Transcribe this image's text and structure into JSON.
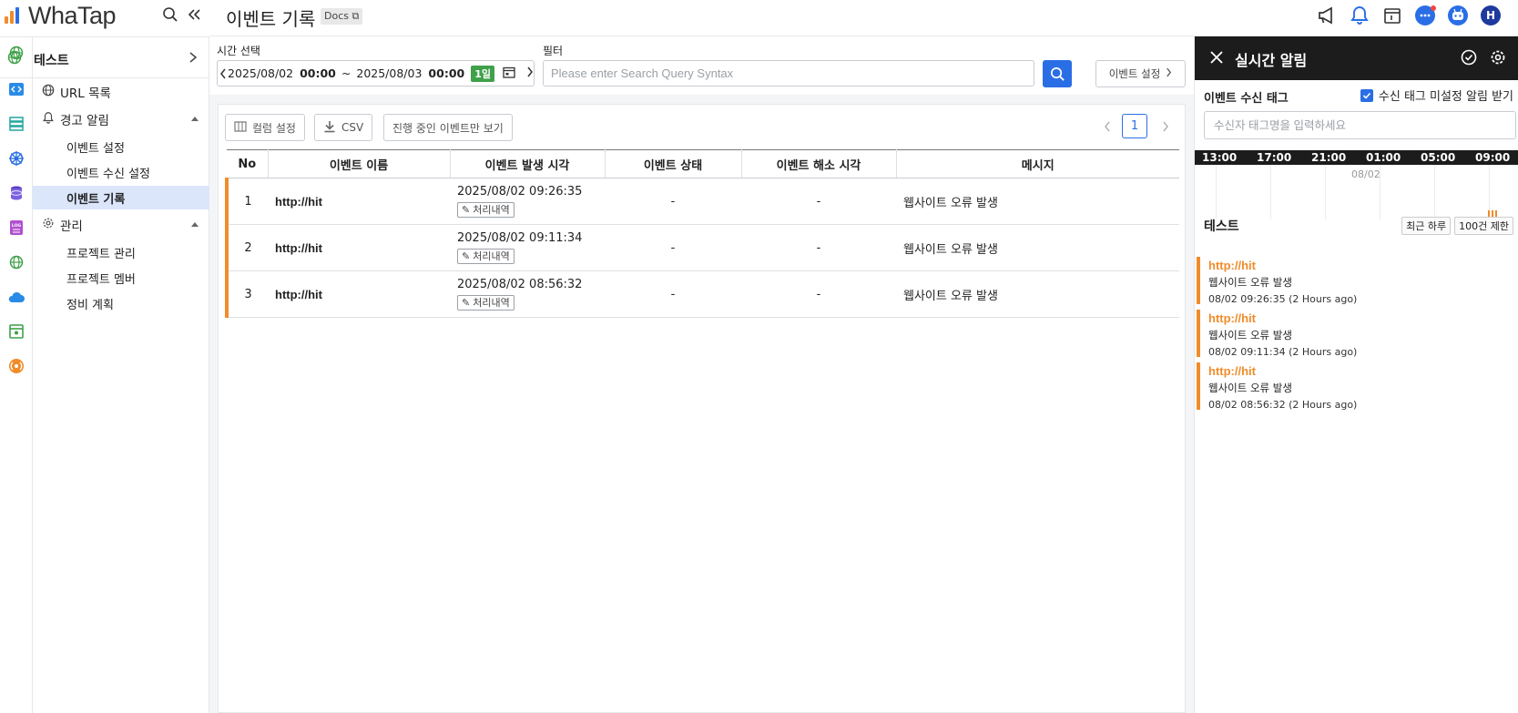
{
  "app": {
    "logo": "WhaTap"
  },
  "header": {
    "title": "이벤트 기록",
    "docs_label": "Docs"
  },
  "sidebar": {
    "project_name": "테스트",
    "items": [
      {
        "label": "URL 목록",
        "level": 1
      },
      {
        "label": "경고 알림",
        "level": 1
      },
      {
        "label": "이벤트 설정",
        "level": 2
      },
      {
        "label": "이벤트 수신 설정",
        "level": 2
      },
      {
        "label": "이벤트 기록",
        "level": 2,
        "active": true
      },
      {
        "label": "관리",
        "level": 1
      },
      {
        "label": "프로젝트 관리",
        "level": 2
      },
      {
        "label": "프로젝트 멤버",
        "level": 2
      },
      {
        "label": "정비 계획",
        "level": 2
      }
    ]
  },
  "filters": {
    "time_label": "시간 선택",
    "filter_label": "필터",
    "start_date": "2025/08/02",
    "start_time": "00:00",
    "separator": "~",
    "end_date": "2025/08/03",
    "end_time": "00:00",
    "range_badge": "1일",
    "filter_placeholder": "Please enter Search Query Syntax",
    "event_settings_button": "이벤트 설정"
  },
  "toolbar": {
    "column_settings": "컬럼 설정",
    "csv": "CSV",
    "ongoing_only": "진행 중인 이벤트만 보기",
    "current_page": "1"
  },
  "table": {
    "columns": [
      "No",
      "이벤트 이름",
      "이벤트 발생 시각",
      "이벤트 상태",
      "이벤트 해소 시각",
      "메시지"
    ],
    "process_tag": "처리내역",
    "rows": [
      {
        "no": "1",
        "name": "http://hit",
        "time": "2025/08/02 09:26:35",
        "status": "-",
        "resolved": "-",
        "message": "웹사이트 오류 발생"
      },
      {
        "no": "2",
        "name": "http://hit",
        "time": "2025/08/02 09:11:34",
        "status": "-",
        "resolved": "-",
        "message": "웹사이트 오류 발생"
      },
      {
        "no": "3",
        "name": "http://hit",
        "time": "2025/08/02 08:56:32",
        "status": "-",
        "resolved": "-",
        "message": "웹사이트 오류 발생"
      }
    ]
  },
  "right_panel": {
    "title": "실시간 알림",
    "tag_label": "이벤트 수신 태그",
    "checkbox_label": "수신 태그 미설정 알림 받기",
    "checkbox_checked": true,
    "tag_placeholder": "수신자 태그명을 입력하세요",
    "timeline_ticks": [
      "13:00",
      "17:00",
      "21:00",
      "01:00",
      "05:00",
      "09:00"
    ],
    "timeline_date": "08/02",
    "section_name": "테스트",
    "btn_recent": "최근 하루",
    "btn_limit": "100건 제한",
    "alerts": [
      {
        "title": "http://hit",
        "message": "웹사이트 오류 발생",
        "time": "08/02 09:26:35 (2 Hours ago)"
      },
      {
        "title": "http://hit",
        "message": "웹사이트 오류 발생",
        "time": "08/02 09:11:34 (2 Hours ago)"
      },
      {
        "title": "http://hit",
        "message": "웹사이트 오류 발생",
        "time": "08/02 08:56:32 (2 Hours ago)"
      }
    ]
  },
  "colors": {
    "accent": "#2a6ee6",
    "event_bar": "#f08c2a",
    "badge_green": "#3fa14a",
    "active_nav": "#dbe6fb"
  }
}
